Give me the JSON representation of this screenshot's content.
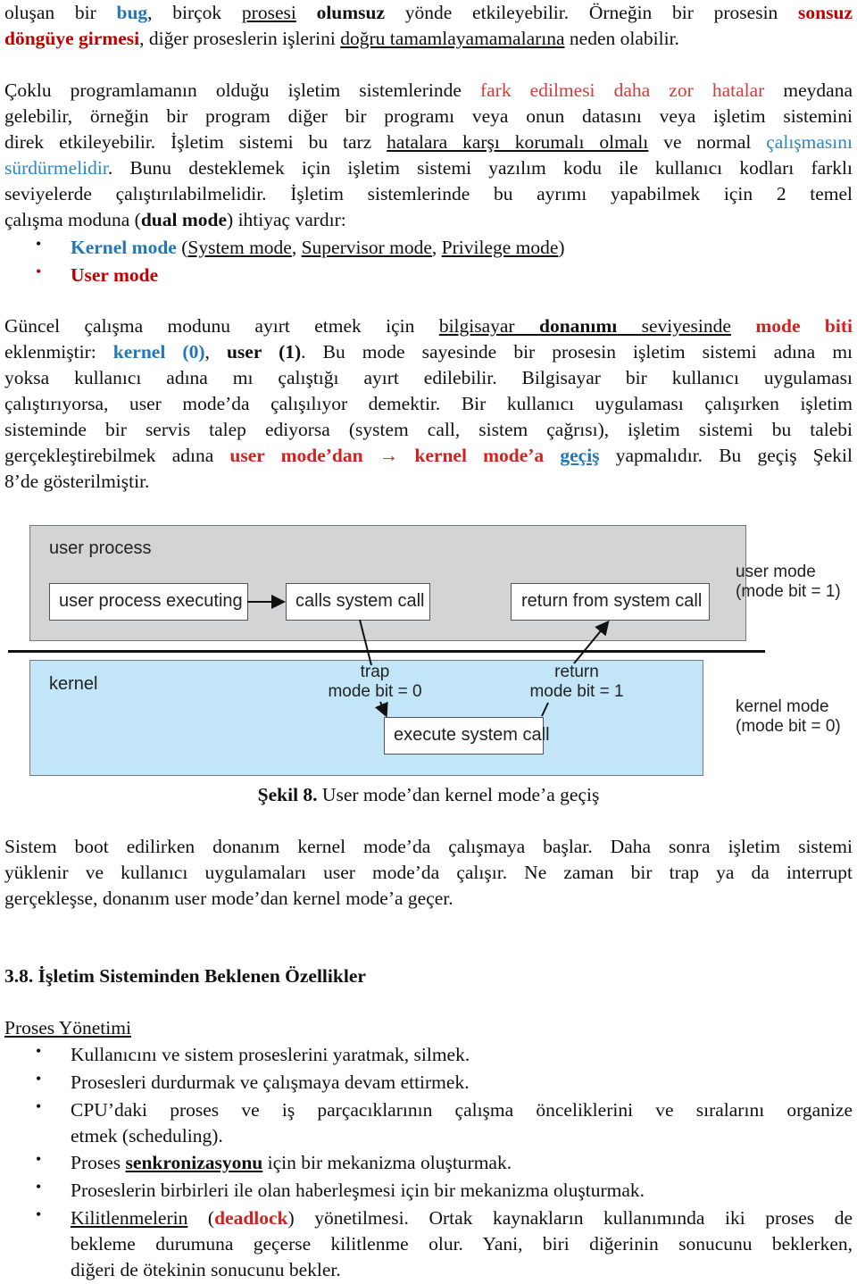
{
  "para1": {
    "line1": {
      "a": "oluşan bir ",
      "bug": "bug",
      "b": ", birçok ",
      "prosesi": "prosesi",
      "c": " ",
      "olumsuz": "olumsuz",
      "d": " yönde etkileyebilir. Örneğin bir prosesin ",
      "sonsuz": "sonsuz"
    },
    "line2": {
      "dongu": "döngüye girmesi",
      "a": ", diğer proseslerin işlerini ",
      "dogru": "doğru tamamlayamamalarına",
      "b": " neden olabilir."
    }
  },
  "para2": {
    "line1": {
      "a": "Çoklu programlamanın olduğu işletim sistemlerinde ",
      "fark": "fark edilmesi daha zor hatalar",
      "b": " meydana"
    },
    "line2": "gelebilir, örneğin bir program diğer bir programı veya onun datasını veya işletim sistemini",
    "line3": {
      "a": "direk etkileyebilir. İşletim sistemi bu tarz ",
      "hatalara": "hatalara karşı korumalı olmalı",
      "b": " ve normal ",
      "calis": "çalışmasını"
    },
    "line4": {
      "surdur": "sürdürmelidir",
      "a": ". Bunu desteklemek için işletim sistemi yazılım kodu ile kullanıcı kodları farklı"
    },
    "line5": "seviyelerde çalıştırılabilmelidir. İşletim sistemlerinde bu ayrımı yapabilmek için 2 temel",
    "line6": {
      "a": "çalışma moduna (",
      "dual": "dual mode",
      "b": ") ihtiyaç vardır:"
    }
  },
  "modes_list": [
    {
      "label": "Kernel mode",
      "paren_open": " (",
      "items": [
        "System mode",
        "Supervisor mode",
        "Privilege mode"
      ],
      "sep": ", ",
      "paren_close": ")"
    },
    {
      "label": "User mode"
    }
  ],
  "para3": {
    "line1": {
      "a": "Güncel çalışma modunu ayırt etmek için ",
      "bilgisayar": "bilgisayar ",
      "donanimi": "donanımı",
      "seviye": " seviyesinde",
      "sp": " ",
      "modebiti": "mode biti"
    },
    "line2": {
      "a": "eklenmiştir: ",
      "kernel": "kernel (0)",
      "b": ", ",
      "user": "user (1)",
      "c": ". Bu mode sayesinde bir prosesin işletim sistemi adına mı"
    },
    "line3": "yoksa kullanıcı adına mı çalıştığı ayırt edilebilir. Bilgisayar bir kullanıcı uygulaması",
    "line4": "çalıştırıyorsa, user mode’da çalışılıyor demektir. Bir kullanıcı uygulaması çalışırken işletim",
    "line5": "sisteminde bir servis talep ediyorsa (system call, sistem çağrısı), işletim sistemi bu talebi",
    "line6": {
      "a": "gerçekleştirebilmek adına ",
      "usermode": "user mode’dan ",
      "arrow": "→",
      "kernelmode": " kernel mode’a",
      "sp": " ",
      "gecis": "geçiş",
      "b": " yapmalıdır. Bu geçiş Şekil"
    },
    "line7": "8’de gösterilmiştir."
  },
  "diagram": {
    "user_process": "user process",
    "user_process_executing": "user process executing",
    "calls_system_call": "calls system call",
    "return_from_system_call": "return from system call",
    "user_mode_line1": "user mode",
    "user_mode_line2": "(mode bit = 1)",
    "kernel": "kernel",
    "trap_line1": "trap",
    "trap_line2": "mode bit = 0",
    "return_line1": "return",
    "return_line2": "mode bit = 1",
    "execute_system_call": "execute system call",
    "kernel_mode_line1": "kernel mode",
    "kernel_mode_line2": "(mode bit = 0)",
    "colors": {
      "user_area": "#d3d4d6",
      "kernel_area": "#c2e5f8"
    }
  },
  "caption": {
    "label": "Şekil 8.",
    "text": " User mode’dan kernel mode’a geçiş"
  },
  "para4": {
    "line1": "Sistem boot edilirken donanım kernel mode’da çalışmaya başlar. Daha sonra işletim sistemi",
    "line2": "yüklenir ve kullanıcı uygulamaları user mode’da çalışır. Ne zaman bir trap ya da interrupt",
    "line3": "gerçekleşse, donanım user mode’dan kernel mode’a geçer."
  },
  "section_heading": "3.8. İşletim Sisteminden Beklenen Özellikler",
  "subheading": "Proses Yönetimi",
  "features": {
    "item1": "Kullanıcını ve sistem proseslerini yaratmak, silmek.",
    "item2": "Prosesleri durdurmak ve çalışmaya devam ettirmek.",
    "item3_line1": "CPU’daki proses ve iş parçacıklarının çalışma önceliklerini ve sıralarını organize",
    "item3_line2": "etmek (scheduling).",
    "item4": {
      "a": "Proses ",
      "senk": "senkronizasyonu",
      "b": " için bir mekanizma oluşturmak."
    },
    "item5": "Proseslerin birbirleri ile olan haberleşmesi için bir mekanizma oluşturmak.",
    "item6": {
      "kilit": "Kilitlenmelerin",
      "a": " (",
      "deadlock": "deadlock",
      "b": ") yönetilmesi. Ortak kaynakların kullanımında iki proses de",
      "line2": "bekleme durumuna geçerse kilitlenme olur. Yani, biri diğerinin sonucunu beklerken,",
      "line3": "diğeri de ötekinin sonucunu bekler."
    }
  },
  "bullet_glyph": "•",
  "colors": {
    "blue": "#2277b7",
    "red": "#c00000"
  }
}
